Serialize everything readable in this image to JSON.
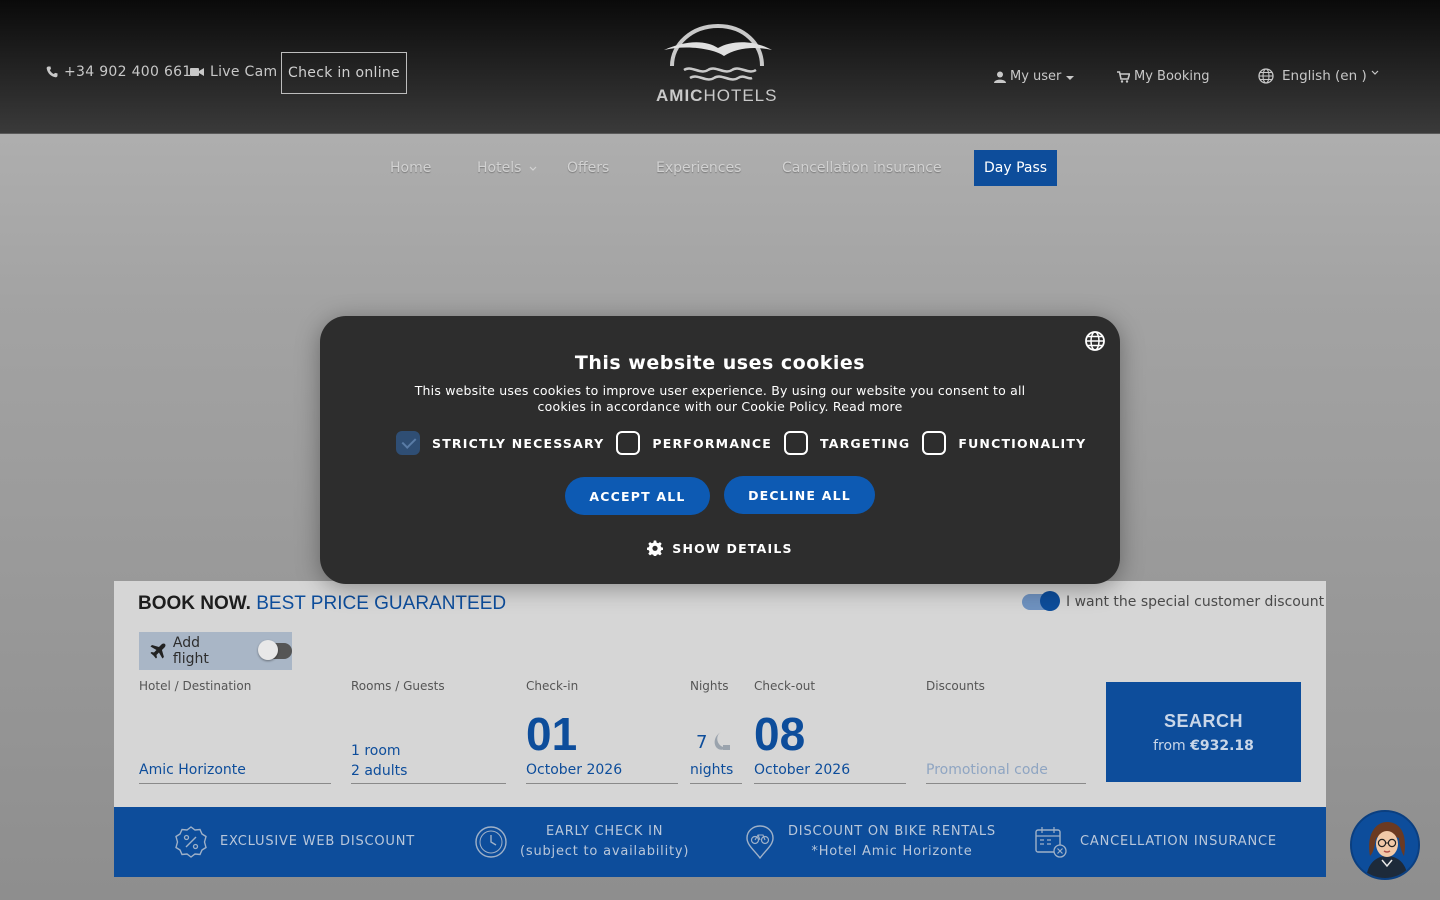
{
  "header": {
    "phone": "+34 902 400 661",
    "live_cam": "Live Cam",
    "check_in_online": "Check in online",
    "brand_bold": "AMIC",
    "brand_rest": "HOTELS",
    "my_user": "My user",
    "my_booking": "My Booking",
    "language": "English (en )"
  },
  "nav": {
    "items": [
      "Home",
      "Hotels",
      "Offers",
      "Experiences",
      "Cancellation insurance",
      "Day Pass"
    ]
  },
  "cookie": {
    "title": "This website uses cookies",
    "text": "This website uses cookies to improve user experience. By using our website you consent to all cookies in accordance with our Cookie Policy. Read more",
    "options": [
      {
        "label": "STRICTLY NECESSARY",
        "checked": true
      },
      {
        "label": "PERFORMANCE",
        "checked": false
      },
      {
        "label": "TARGETING",
        "checked": false
      },
      {
        "label": "FUNCTIONALITY",
        "checked": false
      }
    ],
    "accept_all": "ACCEPT ALL",
    "decline_all": "DECLINE ALL",
    "show_details": "SHOW DETAILS"
  },
  "booking": {
    "title_bold": "BOOK NOW.",
    "title_blue": "BEST PRICE GUARANTEED",
    "special_discount": "I want the special customer discount",
    "add_flight": "Add flight",
    "labels": {
      "hotel": "Hotel / Destination",
      "rooms": "Rooms / Guests",
      "checkin": "Check-in",
      "nights": "Nights",
      "checkout": "Check-out",
      "discounts": "Discounts"
    },
    "hotel_value": "Amic Horizonte",
    "rooms_value": "1 room",
    "guests_value": "2 adults",
    "checkin_day": "01",
    "checkin_month": "October 2026",
    "nights_count": "7",
    "nights_word": "nights",
    "checkout_day": "08",
    "checkout_month": "October 2026",
    "promo_placeholder": "Promotional code",
    "search": "SEARCH",
    "from_label": "from",
    "from_price": "€932.18"
  },
  "benefits": [
    {
      "line1": "EXCLUSIVE WEB DISCOUNT",
      "line2": ""
    },
    {
      "line1": "EARLY CHECK IN",
      "line2": "(subject to availability)"
    },
    {
      "line1": "DISCOUNT ON BIKE RENTALS",
      "line2": "*Hotel Amic Horizonte"
    },
    {
      "line1": "CANCELLATION INSURANCE",
      "line2": ""
    }
  ],
  "colors": {
    "brand_blue": "#0d4d9b",
    "modal_bg": "#2d2d2d",
    "button_blue": "#0d5ab3"
  }
}
